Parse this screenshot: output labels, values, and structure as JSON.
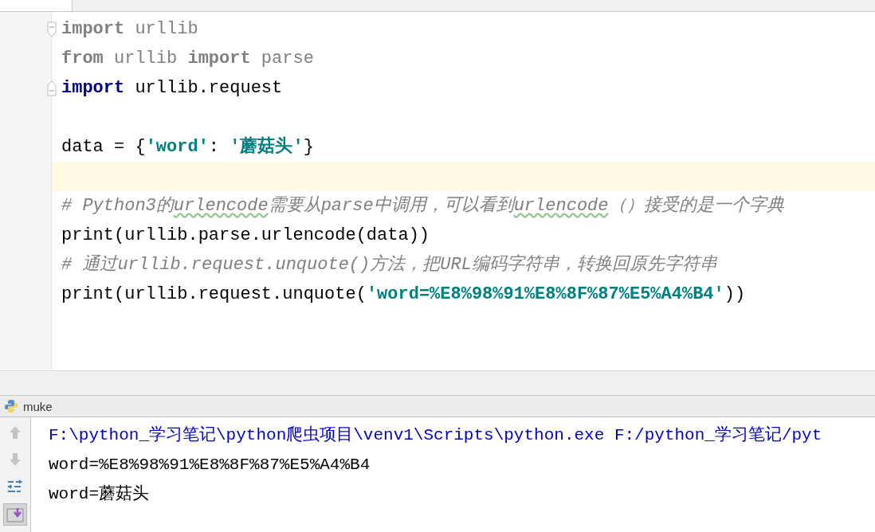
{
  "editor": {
    "lines": [
      {
        "kind": "fold-start",
        "current": false,
        "tokens": [
          {
            "kind": "unused-keyword",
            "text": "import"
          },
          {
            "kind": "unused",
            "text": " urllib"
          }
        ]
      },
      {
        "kind": "line",
        "current": false,
        "tokens": [
          {
            "kind": "unused-keyword",
            "text": "from"
          },
          {
            "kind": "unused",
            "text": " urllib "
          },
          {
            "kind": "unused-keyword",
            "text": "import"
          },
          {
            "kind": "unused",
            "text": " parse"
          }
        ]
      },
      {
        "kind": "fold-end",
        "current": false,
        "tokens": [
          {
            "kind": "keyword",
            "text": "import"
          },
          {
            "kind": "plain",
            "text": " urllib.request"
          }
        ]
      },
      {
        "kind": "line",
        "current": false
      },
      {
        "kind": "line",
        "current": false,
        "tokens": [
          {
            "kind": "plain",
            "text": "data = {"
          },
          {
            "kind": "string",
            "text": "'word'"
          },
          {
            "kind": "plain",
            "text": ": "
          },
          {
            "kind": "string",
            "text": "'蘑菇头'"
          },
          {
            "kind": "plain",
            "text": "}"
          }
        ]
      },
      {
        "kind": "line",
        "current": true
      },
      {
        "kind": "line",
        "current": false,
        "tokens": [
          {
            "kind": "comment",
            "text": "# Python3的"
          },
          {
            "kind": "comment-typo",
            "text": "urlencode"
          },
          {
            "kind": "comment",
            "text": "需要从parse中调用，可以看到"
          },
          {
            "kind": "comment-typo",
            "text": "urlencode"
          },
          {
            "kind": "comment",
            "text": "（）接受的是一个字典"
          }
        ]
      },
      {
        "kind": "line",
        "current": false,
        "tokens": [
          {
            "kind": "plain",
            "text": "print(urllib.parse.urlencode(data))"
          }
        ]
      },
      {
        "kind": "line",
        "current": false,
        "tokens": [
          {
            "kind": "comment",
            "text": "# 通过urllib.request.unquote()方法，把URL编码字符串，转换回原先字符串"
          }
        ]
      },
      {
        "kind": "line",
        "current": false,
        "tokens": [
          {
            "kind": "plain",
            "text": "print(urllib.request.unquote("
          },
          {
            "kind": "string",
            "text": "'word=%E8%98%91%E8%8F%87%E5%A4%B4'"
          },
          {
            "kind": "plain",
            "text": "))"
          }
        ]
      }
    ]
  },
  "run_panel": {
    "tab": "muke",
    "tools": [
      {
        "kind": "up",
        "selected": false
      },
      {
        "kind": "down",
        "selected": false
      },
      {
        "kind": "wrap",
        "selected": false
      },
      {
        "kind": "scroll-end",
        "selected": true
      }
    ],
    "output": [
      {
        "kind": "command",
        "text": "F:\\python_学习笔记\\python爬虫项目\\venv1\\Scripts\\python.exe F:/python_学习笔记/pyt"
      },
      {
        "kind": "stdout",
        "text": "word=%E8%98%91%E8%8F%87%E5%A4%B4"
      },
      {
        "kind": "stdout",
        "text": "word=蘑菇头"
      }
    ]
  }
}
